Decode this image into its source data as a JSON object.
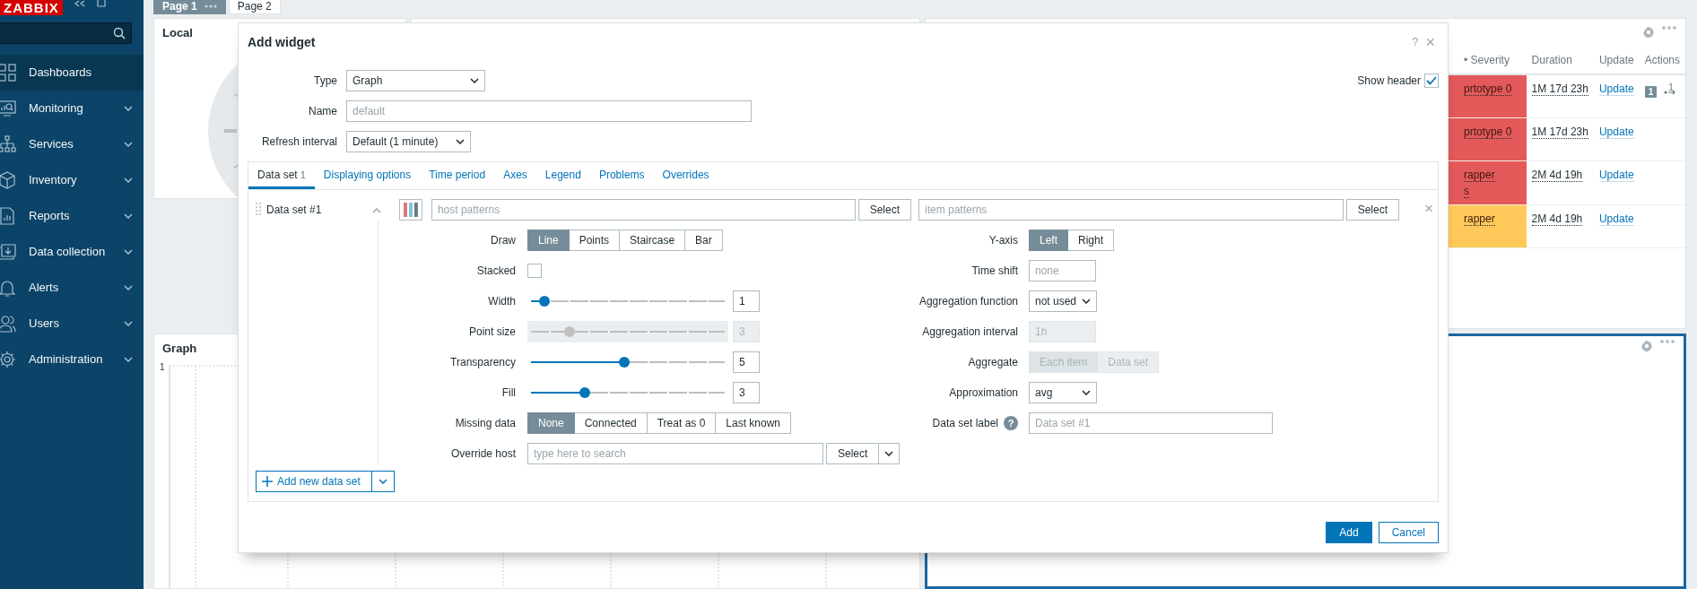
{
  "sidebar": {
    "logo": "ZABBIX",
    "items": [
      {
        "label": "Dashboards",
        "selected": true,
        "expandable": false
      },
      {
        "label": "Monitoring",
        "selected": false,
        "expandable": true
      },
      {
        "label": "Services",
        "selected": false,
        "expandable": true
      },
      {
        "label": "Inventory",
        "selected": false,
        "expandable": true
      },
      {
        "label": "Reports",
        "selected": false,
        "expandable": true
      },
      {
        "label": "Data collection",
        "selected": false,
        "expandable": true
      },
      {
        "label": "Alerts",
        "selected": false,
        "expandable": true
      },
      {
        "label": "Users",
        "selected": false,
        "expandable": true
      },
      {
        "label": "Administration",
        "selected": false,
        "expandable": true
      }
    ]
  },
  "dashboard": {
    "pages": [
      {
        "label": "Page 1",
        "selected": true
      },
      {
        "label": "Page 2",
        "selected": false
      }
    ],
    "clock_widget": {
      "title": "Local"
    },
    "graph_widget": {
      "title": "Graph",
      "y_tick": "1"
    },
    "problems_widget": {
      "columns": [
        "• Severity",
        "Duration",
        "Update",
        "Actions"
      ],
      "rows": [
        {
          "severity_lines": [
            "prtotype 0"
          ],
          "color": "#e45959",
          "duration": "1M 17d 23h",
          "update": "Update",
          "message_count": "1",
          "action_count": "1"
        },
        {
          "severity_lines": [
            "prtotype 0"
          ],
          "color": "#e45959",
          "duration": "1M 17d 23h",
          "update": "Update"
        },
        {
          "severity_lines": [
            "rapper",
            "s"
          ],
          "color": "#e45959",
          "duration": "2M 4d 19h",
          "update": "Update"
        },
        {
          "severity_lines": [
            "rapper"
          ],
          "color": "#ffc859",
          "duration": "2M 4d 19h",
          "update": "Update"
        }
      ]
    }
  },
  "modal": {
    "title": "Add widget",
    "help": "?",
    "close": "×",
    "type": {
      "label": "Type",
      "value": "Graph"
    },
    "name": {
      "label": "Name",
      "placeholder": "default"
    },
    "refresh": {
      "label": "Refresh interval",
      "value": "Default (1 minute)"
    },
    "show_header": {
      "label": "Show header",
      "checked": true
    },
    "tabs": [
      {
        "label": "Data set",
        "count": "1",
        "selected": true
      },
      {
        "label": "Displaying options",
        "selected": false
      },
      {
        "label": "Time period",
        "selected": false
      },
      {
        "label": "Axes",
        "selected": false
      },
      {
        "label": "Legend",
        "selected": false
      },
      {
        "label": "Problems",
        "selected": false
      },
      {
        "label": "Overrides",
        "selected": false
      }
    ],
    "data_set": {
      "name": "Data set #1",
      "expanded": true,
      "host_placeholder": "host patterns",
      "host_button": "Select",
      "item_placeholder": "item patterns",
      "item_button": "Select",
      "remove": "×",
      "left_rows": [
        {
          "kind": "segmented",
          "label": "Draw",
          "options": [
            {
              "label": "Line",
              "selected": true
            },
            {
              "label": "Points",
              "selected": false
            },
            {
              "label": "Staircase",
              "selected": false
            },
            {
              "label": "Bar",
              "selected": false
            }
          ]
        },
        {
          "kind": "checkbox",
          "label": "Stacked",
          "checked": false
        },
        {
          "kind": "slider",
          "label": "Width",
          "level": 0.07,
          "value": "1"
        },
        {
          "kind": "slider",
          "label": "Point size",
          "level": 0.2,
          "value": "3",
          "disabled": true
        },
        {
          "kind": "slider",
          "label": "Transparency",
          "level": 0.48,
          "value": "5"
        },
        {
          "kind": "slider",
          "label": "Fill",
          "level": 0.28,
          "value": "3"
        },
        {
          "kind": "segmented",
          "label": "Missing data",
          "options": [
            {
              "label": "None",
              "selected": true
            },
            {
              "label": "Connected",
              "selected": false
            },
            {
              "label": "Treat as 0",
              "selected": false
            },
            {
              "label": "Last known",
              "selected": false
            }
          ]
        },
        {
          "kind": "search",
          "label": "Override host",
          "placeholder": "type here to search",
          "button": "Select"
        }
      ],
      "right_rows": [
        {
          "kind": "segmented",
          "label": "Y-axis",
          "options": [
            {
              "label": "Left",
              "selected": true
            },
            {
              "label": "Right",
              "selected": false
            }
          ]
        },
        {
          "kind": "input",
          "label": "Time shift",
          "placeholder": "none"
        },
        {
          "kind": "select",
          "label": "Aggregation function",
          "value": "not used"
        },
        {
          "kind": "input",
          "label": "Aggregation interval",
          "value": "1h",
          "disabled": true
        },
        {
          "kind": "segmented",
          "label": "Aggregate",
          "disabled": true,
          "options": [
            {
              "label": "Each item",
              "selected": true
            },
            {
              "label": "Data set",
              "selected": false
            }
          ]
        },
        {
          "kind": "select",
          "label": "Approximation",
          "value": "avg"
        },
        {
          "kind": "input",
          "label": "Data set label",
          "placeholder": "Data set #1",
          "help": "?",
          "wide": true
        }
      ]
    },
    "add_data_set": "Add new data set",
    "buttons": [
      {
        "label": "Add",
        "kind": "primary"
      },
      {
        "label": "Cancel",
        "kind": "secondary"
      }
    ]
  }
}
